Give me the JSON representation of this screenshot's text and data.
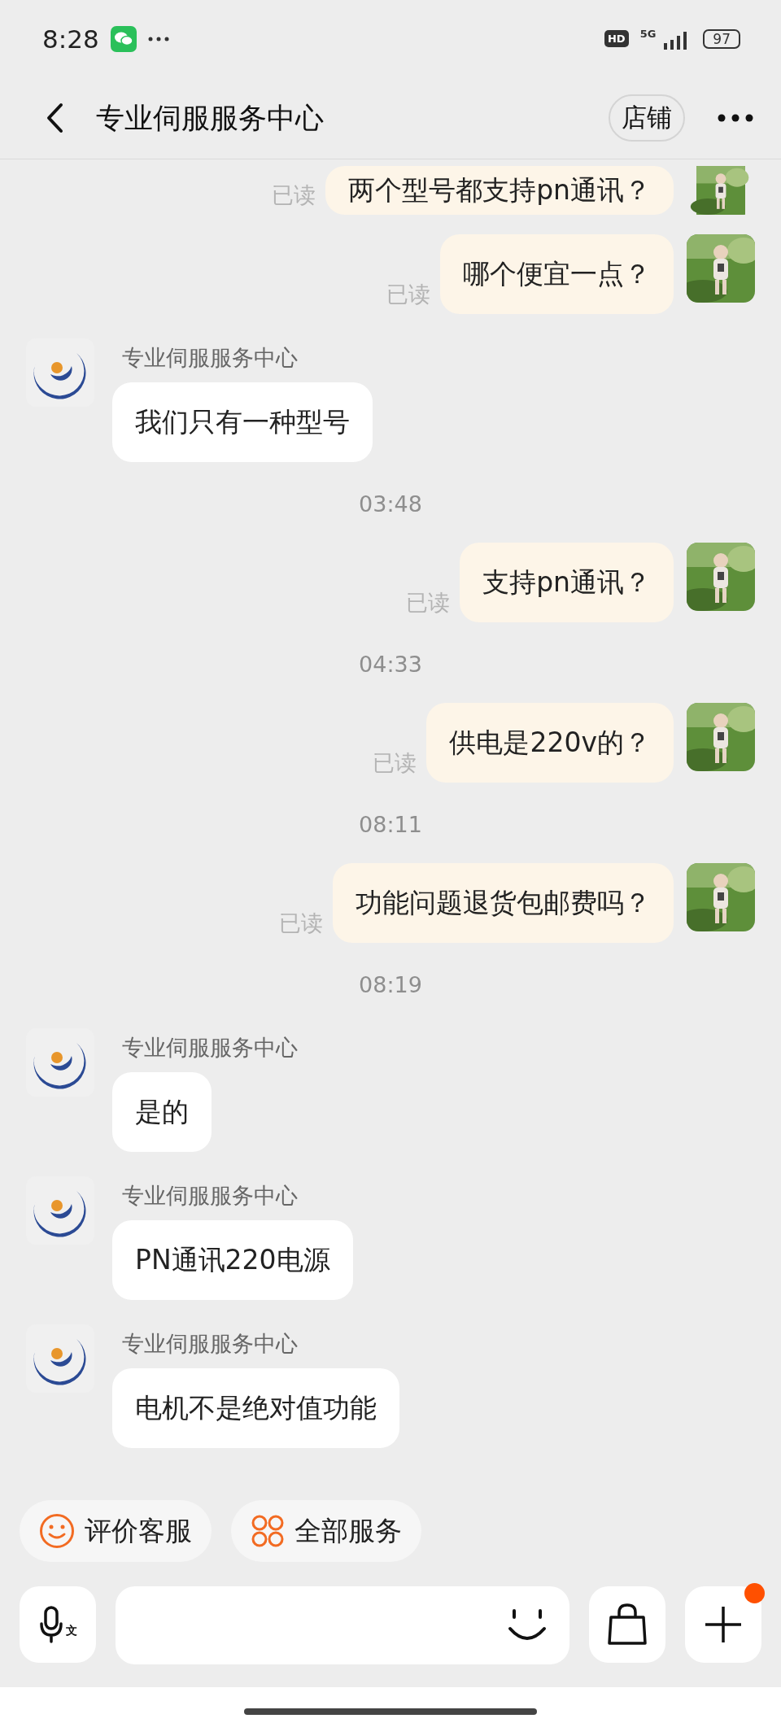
{
  "status_bar": {
    "time": "8:28",
    "hd": "HD",
    "network": "5G",
    "battery": "97"
  },
  "header": {
    "title": "专业伺服服务中心",
    "shop_button": "店铺"
  },
  "messages": [
    {
      "kind": "sent",
      "text": "两个型号都支持pn通讯？",
      "read": "已读"
    },
    {
      "kind": "sent",
      "text": "哪个便宜一点？",
      "read": "已读"
    },
    {
      "kind": "received",
      "sender": "专业伺服服务中心",
      "text": "我们只有一种型号"
    },
    {
      "kind": "time",
      "text": "03:48"
    },
    {
      "kind": "sent",
      "text": "支持pn通讯？",
      "read": "已读"
    },
    {
      "kind": "time",
      "text": "04:33"
    },
    {
      "kind": "sent",
      "text": "供电是220v的？",
      "read": "已读"
    },
    {
      "kind": "time",
      "text": "08:11"
    },
    {
      "kind": "sent",
      "text": "功能问题退货包邮费吗？",
      "read": "已读"
    },
    {
      "kind": "time",
      "text": "08:19"
    },
    {
      "kind": "received",
      "sender": "专业伺服服务中心",
      "text": "是的"
    },
    {
      "kind": "received",
      "sender": "专业伺服服务中心",
      "text": "PN通讯220电源"
    },
    {
      "kind": "received",
      "sender": "专业伺服服务中心",
      "text": "电机不是绝对值功能"
    }
  ],
  "quick_actions": [
    {
      "kind": "rate",
      "label": "评价客服"
    },
    {
      "kind": "services",
      "label": "全部服务"
    }
  ],
  "input_bar": {
    "voice_mark": "文",
    "plus_badge": true
  }
}
